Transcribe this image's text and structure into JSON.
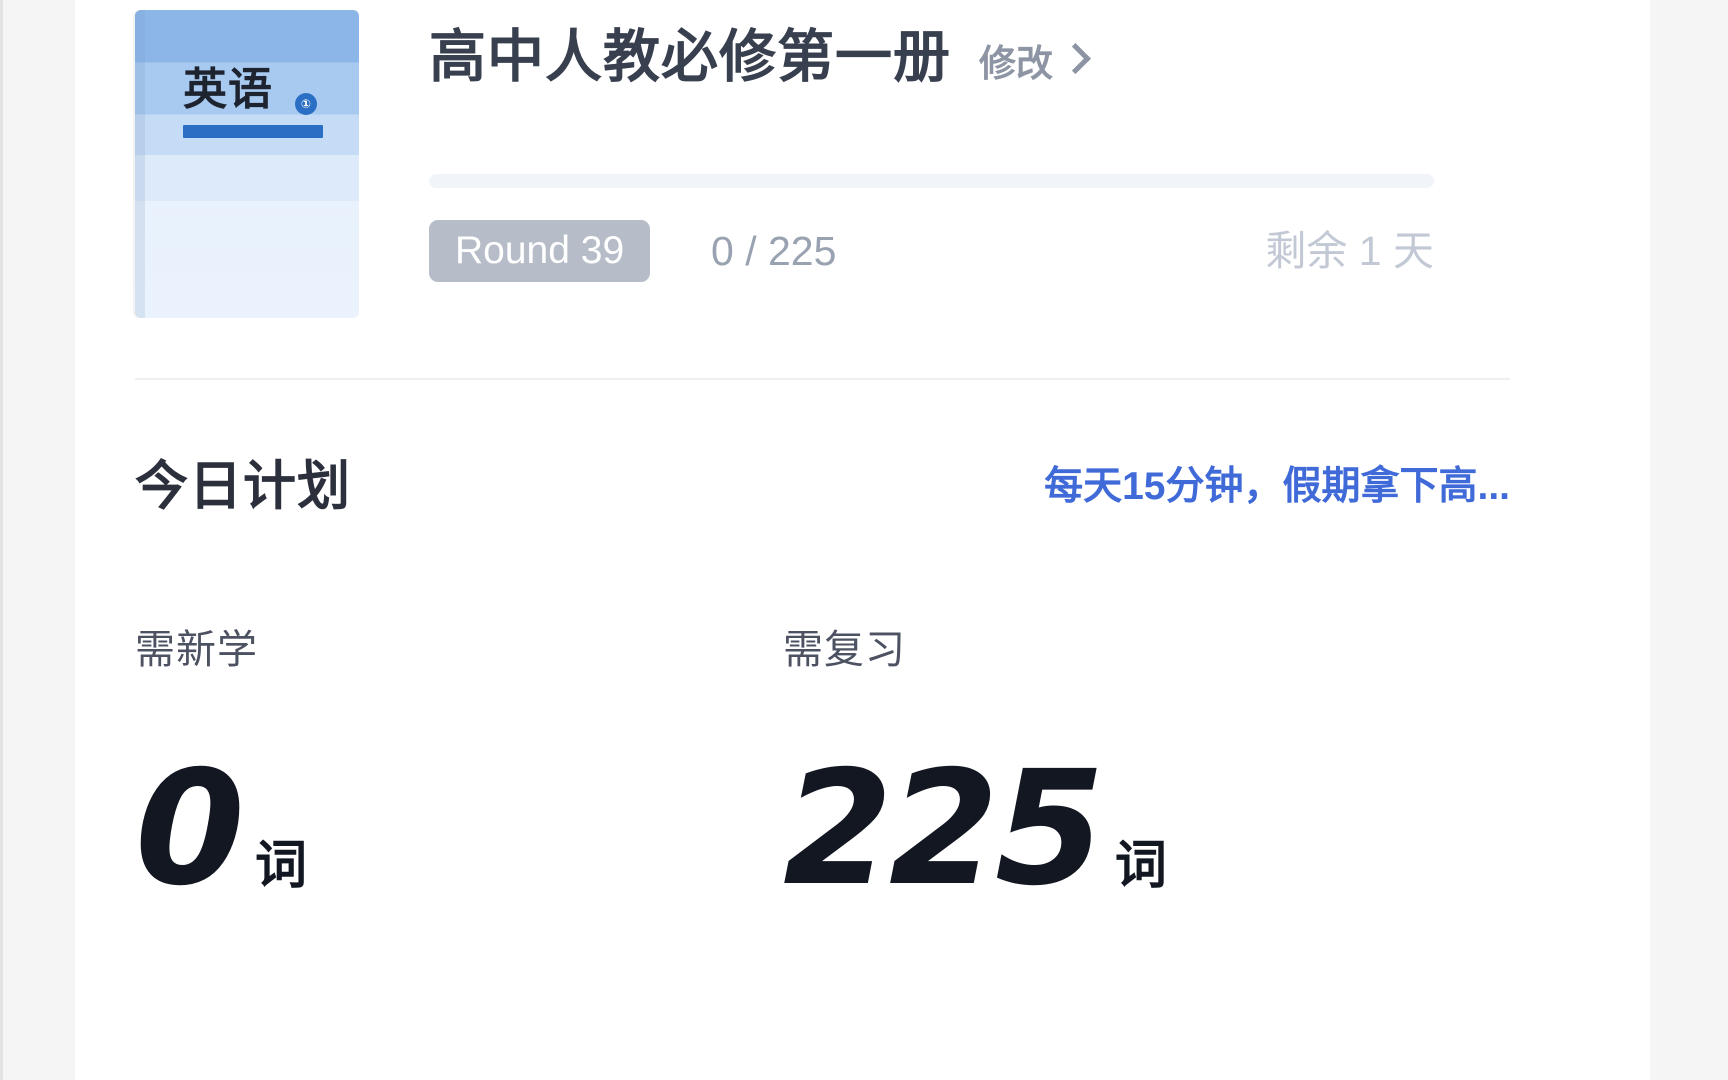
{
  "book": {
    "cover": {
      "subject_label": "英语",
      "badge_label": "①",
      "icon": "textbook-cover"
    },
    "name": "高中人教必修第一册",
    "edit_label": "修改",
    "edit_chevron_icon": "chevron-right-icon",
    "progress": {
      "percent": 0,
      "round_badge": "Round 39",
      "count_text": "0 / 225",
      "current": 0,
      "total": 225,
      "remaining_text": "剩余 1 天"
    }
  },
  "plan": {
    "title": "今日计划",
    "promo_link": "每天15分钟，假期拿下高...",
    "stats": [
      {
        "label": "需新学",
        "value": "0",
        "unit": "词"
      },
      {
        "label": "需复习",
        "value": "225",
        "unit": "词"
      }
    ]
  },
  "colors": {
    "accent_blue": "#3f6ad8",
    "cover_blue": "#2b6fc4",
    "badge_gray": "#b6bdc8",
    "muted_text": "#99a2b1",
    "faint_text": "#c2c9d4",
    "title_text": "#38404f",
    "number_text": "#121721",
    "page_bg": "#f5f5f6",
    "card_bg": "#ffffff"
  }
}
